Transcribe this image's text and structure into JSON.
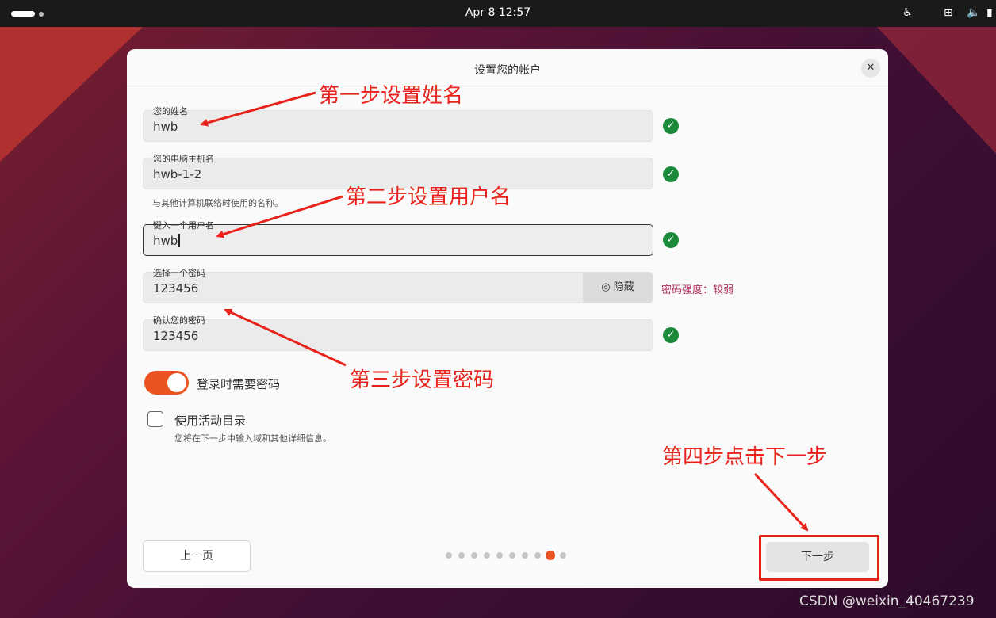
{
  "topbar": {
    "clock": "Apr 8  12:57",
    "tray_icons": [
      "accessibility-icon",
      "network-icon",
      "volume-icon",
      "battery-icon"
    ]
  },
  "dialog": {
    "title": "设置您的帐户",
    "fields": {
      "name": {
        "label": "您的姓名",
        "value": "hwb"
      },
      "hostname": {
        "label": "您的电脑主机名",
        "value": "hwb-1-2",
        "hint": "与其他计算机联络时使用的名称。"
      },
      "username": {
        "label": "键入一个用户名",
        "value": "hwb"
      },
      "password": {
        "label": "选择一个密码",
        "value": "123456",
        "hide_label": "隐藏",
        "strength": "密码强度：较弱"
      },
      "confirm": {
        "label": "确认您的密码",
        "value": "123456"
      }
    },
    "require_password": {
      "label": "登录时需要密码",
      "enabled": true
    },
    "active_directory": {
      "label": "使用活动目录",
      "hint": "您将在下一步中输入域和其他详细信息。",
      "checked": false
    },
    "prev_button": "上一页",
    "next_button": "下一步",
    "pager": {
      "total": 10,
      "current": 9
    }
  },
  "annotations": {
    "step1": "第一步设置姓名",
    "step2": "第二步设置用户名",
    "step3": "第三步设置密码",
    "step4": "第四步点击下一步",
    "color": "#e8231c"
  },
  "watermark": "CSDN @weixin_40467239",
  "colors": {
    "accent": "#e95420",
    "ok": "#1a8a3a",
    "weak": "#b03060"
  }
}
